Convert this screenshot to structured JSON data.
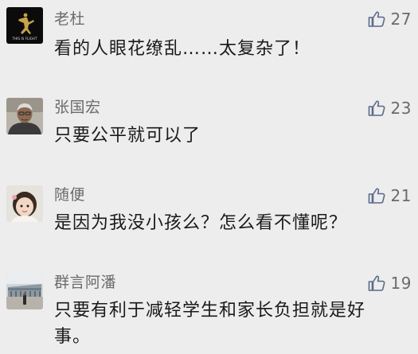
{
  "comments": [
    {
      "author": "老杜",
      "avatar": "jordan-logo-avatar",
      "avatar_caption": "THIS IS FLIGHT",
      "text": "看的人眼花缭乱……太复杂了！",
      "likes": "27"
    },
    {
      "author": "张国宏",
      "avatar": "man-portrait-avatar",
      "text": "只要公平就可以了",
      "likes": "23"
    },
    {
      "author": "随便",
      "avatar": "child-portrait-avatar",
      "text": "是因为我没小孩么？怎么看不懂呢？",
      "likes": "21"
    },
    {
      "author": "群言阿潘",
      "avatar": "building-photo-avatar",
      "text": "只要有利于减轻学生和家长负担就是好事。",
      "likes": "19"
    }
  ],
  "icons": {
    "like": "thumbs-up-outline-icon"
  },
  "colors": {
    "background": "#ededed",
    "name": "#6b6b6b",
    "text": "#1a1a1a",
    "icon": "#5a6a8a"
  }
}
